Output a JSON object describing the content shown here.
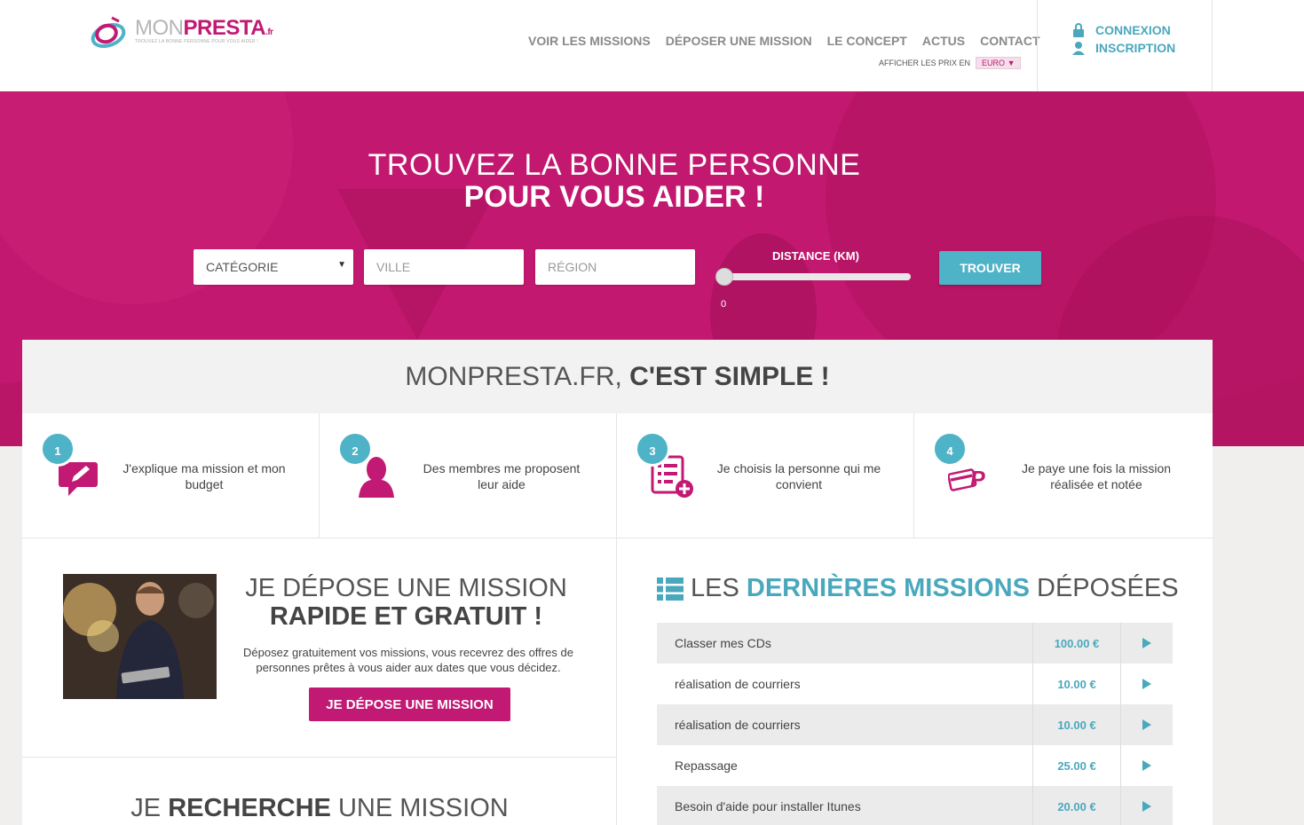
{
  "header": {
    "logo": {
      "part1": "MON",
      "part2": "PRESTA",
      "tld": ".fr",
      "tagline": "TROUVEZ LA BONNE PERSONNE POUR VOUS AIDER !"
    },
    "nav": [
      "VOIR LES MISSIONS",
      "DÉPOSER UNE MISSION",
      "LE CONCEPT",
      "ACTUS",
      "CONTACT"
    ],
    "currency_label": "AFFICHER LES PRIX EN",
    "currency_value": "EURO",
    "login": "CONNEXION",
    "signup": "INSCRIPTION"
  },
  "hero": {
    "title_line1": "TROUVEZ LA BONNE PERSONNE",
    "title_line2": "POUR VOUS AIDER !",
    "category_placeholder": "CATÉGORIE",
    "city_placeholder": "VILLE",
    "region_placeholder": "RÉGION",
    "distance_label": "DISTANCE (KM)",
    "distance_value": "0",
    "find_button": "TROUVER"
  },
  "simple": {
    "title_light": "MONPRESTA.FR,",
    "title_bold": "C'EST SIMPLE !",
    "steps": [
      {
        "num": "1",
        "text": "J'explique ma mission et mon budget",
        "icon": "edit-bubble-icon"
      },
      {
        "num": "2",
        "text": "Des membres me proposent leur aide",
        "icon": "person-head-icon"
      },
      {
        "num": "3",
        "text": "Je choisis la personne qui me convient",
        "icon": "list-add-icon"
      },
      {
        "num": "4",
        "text": "Je paye une fois la mission réalisée et notée",
        "icon": "payment-card-icon"
      }
    ]
  },
  "depose": {
    "title_light": "JE DÉPOSE UNE MISSION",
    "title_bold": "RAPIDE ET GRATUIT !",
    "description": "Déposez gratuitement vos missions, vous recevrez des offres de personnes prêtes à vous aider aux dates que vous décidez.",
    "button": "JE DÉPOSE UNE MISSION"
  },
  "recherche": {
    "part1": "JE",
    "part2": "RECHERCHE",
    "part3": "UNE MISSION"
  },
  "missions": {
    "title_part1": "LES",
    "title_part2": "DERNIÈRES MISSIONS",
    "title_part3": "DÉPOSÉES",
    "items": [
      {
        "name": "Classer mes CDs",
        "price": "100.00 €"
      },
      {
        "name": "réalisation de courriers",
        "price": "10.00 €"
      },
      {
        "name": "réalisation de courriers",
        "price": "10.00 €"
      },
      {
        "name": "Repassage",
        "price": "25.00 €"
      },
      {
        "name": "Besoin d'aide pour installer Itunes",
        "price": "20.00 €"
      }
    ]
  },
  "colors": {
    "brand_pink": "#c21a74",
    "accent_teal": "#4fb3c8"
  }
}
